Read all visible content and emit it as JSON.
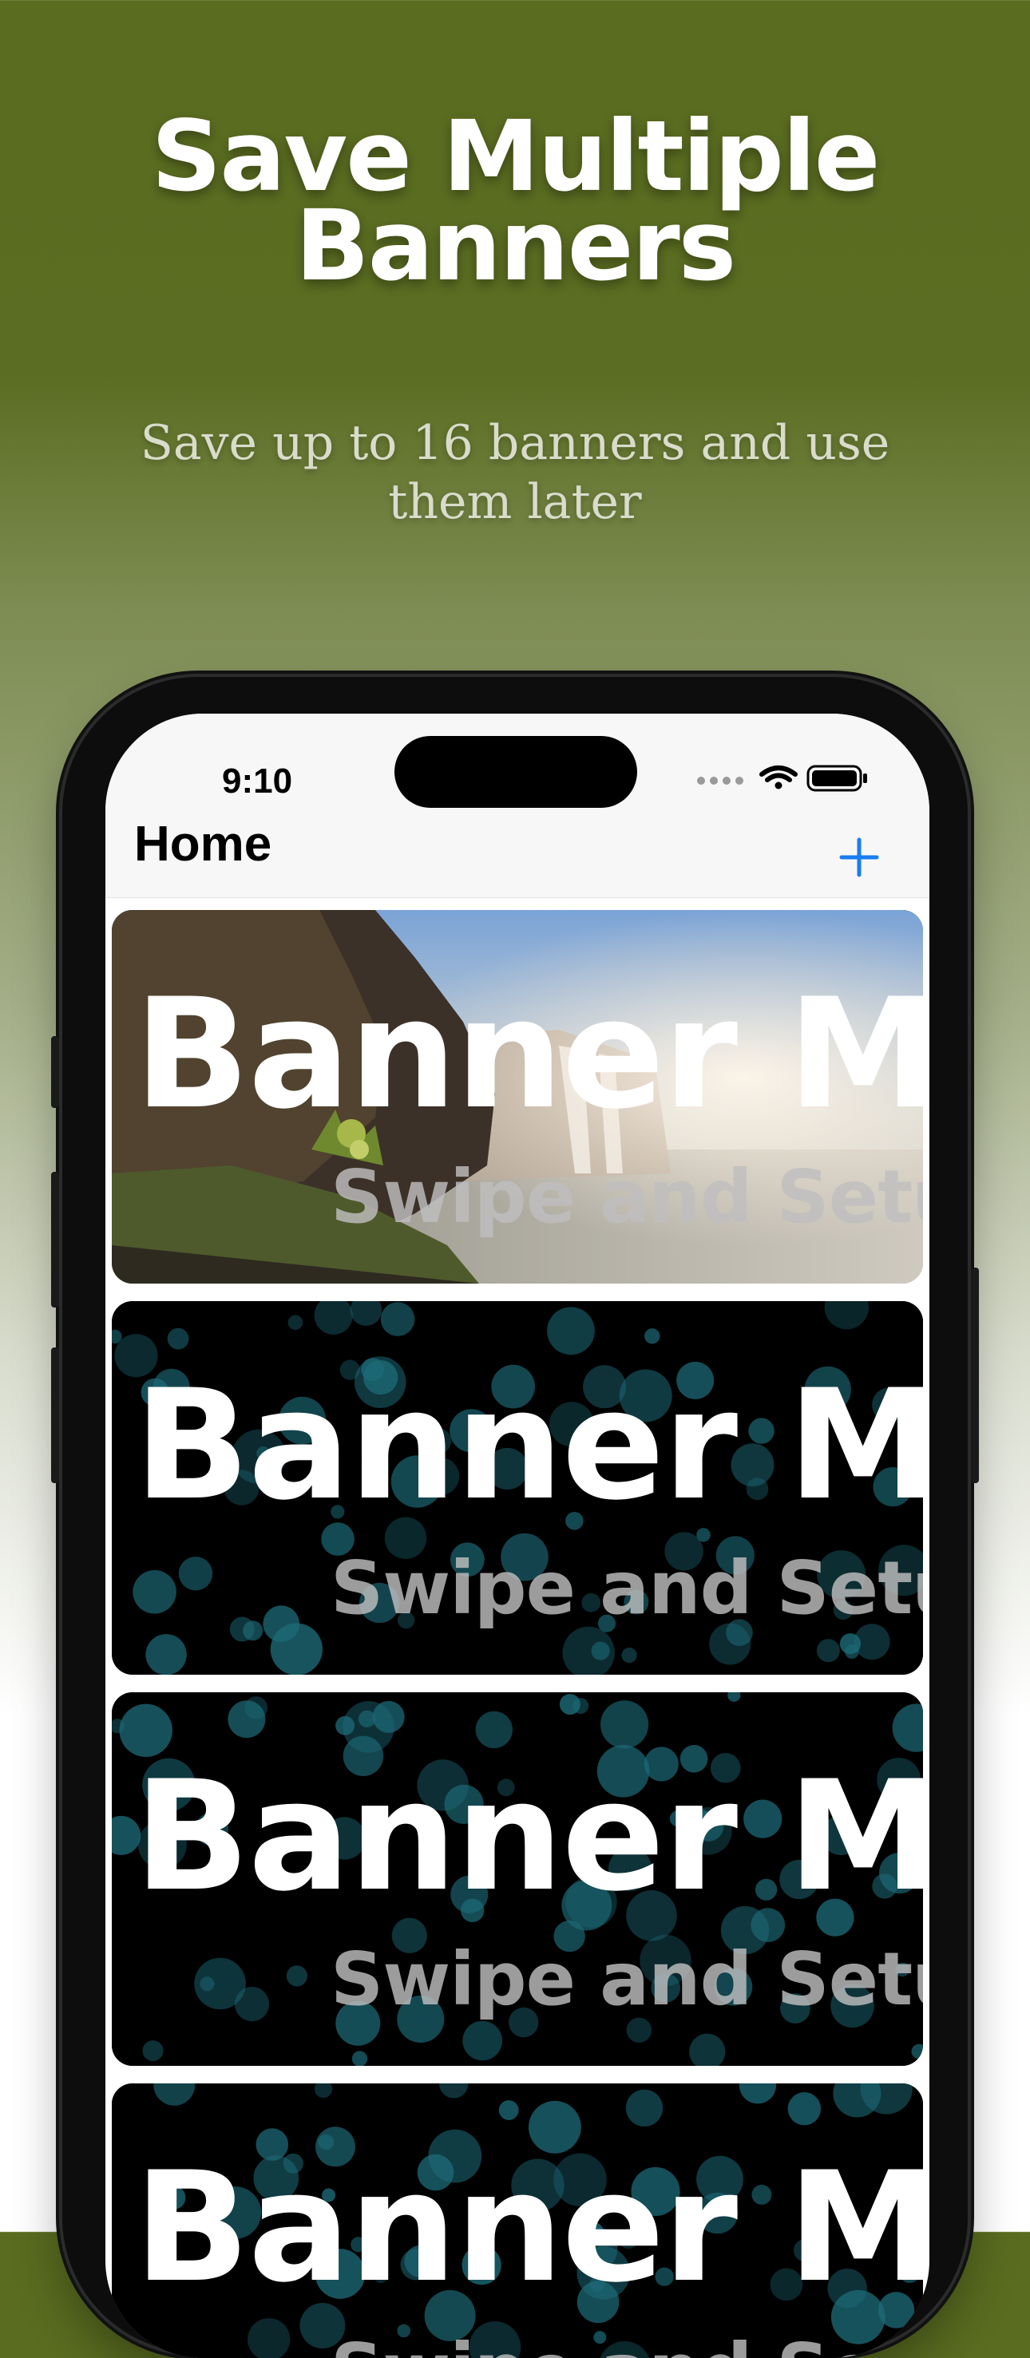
{
  "promo": {
    "headline_line1": "Save Multiple",
    "headline_line2": "Banners",
    "subtitle_line1": "Save up to 16 banners and use",
    "subtitle_line2": "them later"
  },
  "status_bar": {
    "time": "9:10",
    "icons": [
      "signal-dots-icon",
      "wifi-icon",
      "battery-icon"
    ]
  },
  "nav": {
    "title": "Home",
    "add_icon": "plus-icon"
  },
  "banners": [
    {
      "title": "Banner Ma",
      "subtitle": "Swipe and Setu",
      "background": "waterfall-photo"
    },
    {
      "title": "Banner Ma",
      "subtitle": "Swipe and Setu",
      "background": "bokeh-dots"
    },
    {
      "title": "Banner Ma",
      "subtitle": "Swipe and Setu",
      "background": "bokeh-dots"
    },
    {
      "title": "Banner Ma",
      "subtitle": "Swipe and Setu",
      "background": "bokeh-dots"
    }
  ],
  "colors": {
    "background_top": "#596c1f",
    "accent_blue": "#1a7cf2",
    "bokeh": "#1d6b78"
  }
}
